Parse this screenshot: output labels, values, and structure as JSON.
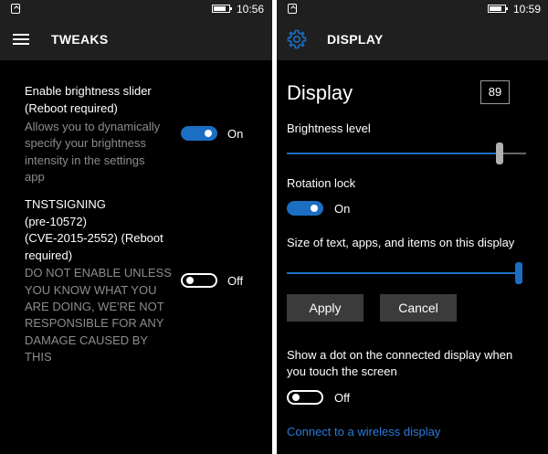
{
  "left": {
    "status": {
      "time": "10:56",
      "battery_level": 0.8
    },
    "header": {
      "title": "TWEAKS",
      "icon": "hamburger-menu-icon"
    },
    "settings": [
      {
        "label_lines": [
          "Enable brightness slider",
          "(Reboot required)"
        ],
        "desc_lines": [
          "Allows you to dynamically",
          "specify your brightness",
          "intensity in the settings",
          "app"
        ],
        "toggle_on": true,
        "toggle_label": "On"
      },
      {
        "label_lines": [
          "TNSTSIGNING",
          "(pre-10572)",
          "(CVE-2015-2552) (Reboot",
          "required)"
        ],
        "desc_lines": [
          "DO NOT ENABLE UNLESS",
          "YOU KNOW WHAT YOU",
          "ARE DOING, WE'RE NOT",
          "RESPONSIBLE FOR ANY",
          "DAMAGE CAUSED BY",
          "THIS"
        ],
        "toggle_on": false,
        "toggle_label": "Off"
      }
    ]
  },
  "right": {
    "status": {
      "time": "10:59",
      "battery_level": 0.8
    },
    "header": {
      "title": "DISPLAY",
      "icon": "gear-icon"
    },
    "page_title": "Display",
    "value_box": "89",
    "brightness": {
      "label": "Brightness level",
      "level": 0.89
    },
    "rotation": {
      "label": "Rotation lock",
      "toggle_label": "On",
      "toggle_on": true
    },
    "scale": {
      "label": "Size of text, apps, and items on this display",
      "level": 1.0
    },
    "apply_label": "Apply",
    "cancel_label": "Cancel",
    "dot": {
      "label_lines": [
        "Show a dot on the connected display when",
        "you touch the screen"
      ],
      "toggle_label": "Off",
      "toggle_on": false
    },
    "connect_link": "Connect to a wireless display",
    "accent_color": "#1b6ec2"
  }
}
